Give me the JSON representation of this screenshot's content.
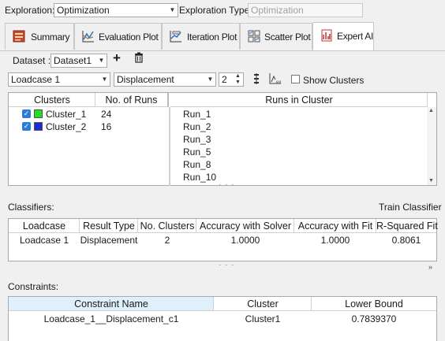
{
  "exploration": {
    "label": "Exploration:",
    "value": "Optimization",
    "type_label": "Exploration Type:",
    "type_value": "Optimization"
  },
  "tabs": [
    {
      "label": "Summary",
      "icon": "summary-icon"
    },
    {
      "label": "Evaluation Plot",
      "icon": "evaluation-plot-icon"
    },
    {
      "label": "Iteration Plot",
      "icon": "iteration-plot-icon"
    },
    {
      "label": "Scatter Plot",
      "icon": "scatter-plot-icon"
    },
    {
      "label": "Expert AI",
      "icon": "expert-ai-icon",
      "active": true
    }
  ],
  "dataset": {
    "label": "Dataset :",
    "value": "Dataset1",
    "add_symbol": "+",
    "delete_symbol": "🗑"
  },
  "filters": {
    "loadcase": "Loadcase 1",
    "result_type": "Displacement",
    "clusters_count": "2",
    "show_clusters_label": "Show Clusters"
  },
  "clusters_table": {
    "headers": [
      "Clusters",
      "No. of Runs"
    ],
    "rows": [
      {
        "name": "Cluster_1",
        "runs": "24",
        "color": "#22dd22"
      },
      {
        "name": "Cluster_2",
        "runs": "16",
        "color": "#1a2bd8"
      }
    ]
  },
  "runs_table": {
    "header": "Runs in Cluster",
    "runs": [
      "Run_1",
      "Run_2",
      "Run_3",
      "Run_5",
      "Run_8",
      "Run_10"
    ]
  },
  "classifiers": {
    "label": "Classifiers:",
    "train_label": "Train Classifier",
    "headers": [
      "Loadcase",
      "Result Type",
      "No. Clusters",
      "Accuracy with Solver",
      "Accuracy with Fit",
      "R-Squared Fit"
    ],
    "rows": [
      [
        "Loadcase 1",
        "Displacement",
        "2",
        "1.0000",
        "1.0000",
        "0.8061"
      ]
    ]
  },
  "constraints": {
    "label": "Constraints:",
    "headers": [
      "Constraint Name",
      "Cluster",
      "Lower Bound"
    ],
    "rows": [
      [
        "Loadcase_1__Displacement_c1",
        "Cluster1",
        "0.7839370"
      ]
    ]
  },
  "colors": {
    "accent": "#2b7bd8",
    "selected_header": "#dff0fb"
  }
}
